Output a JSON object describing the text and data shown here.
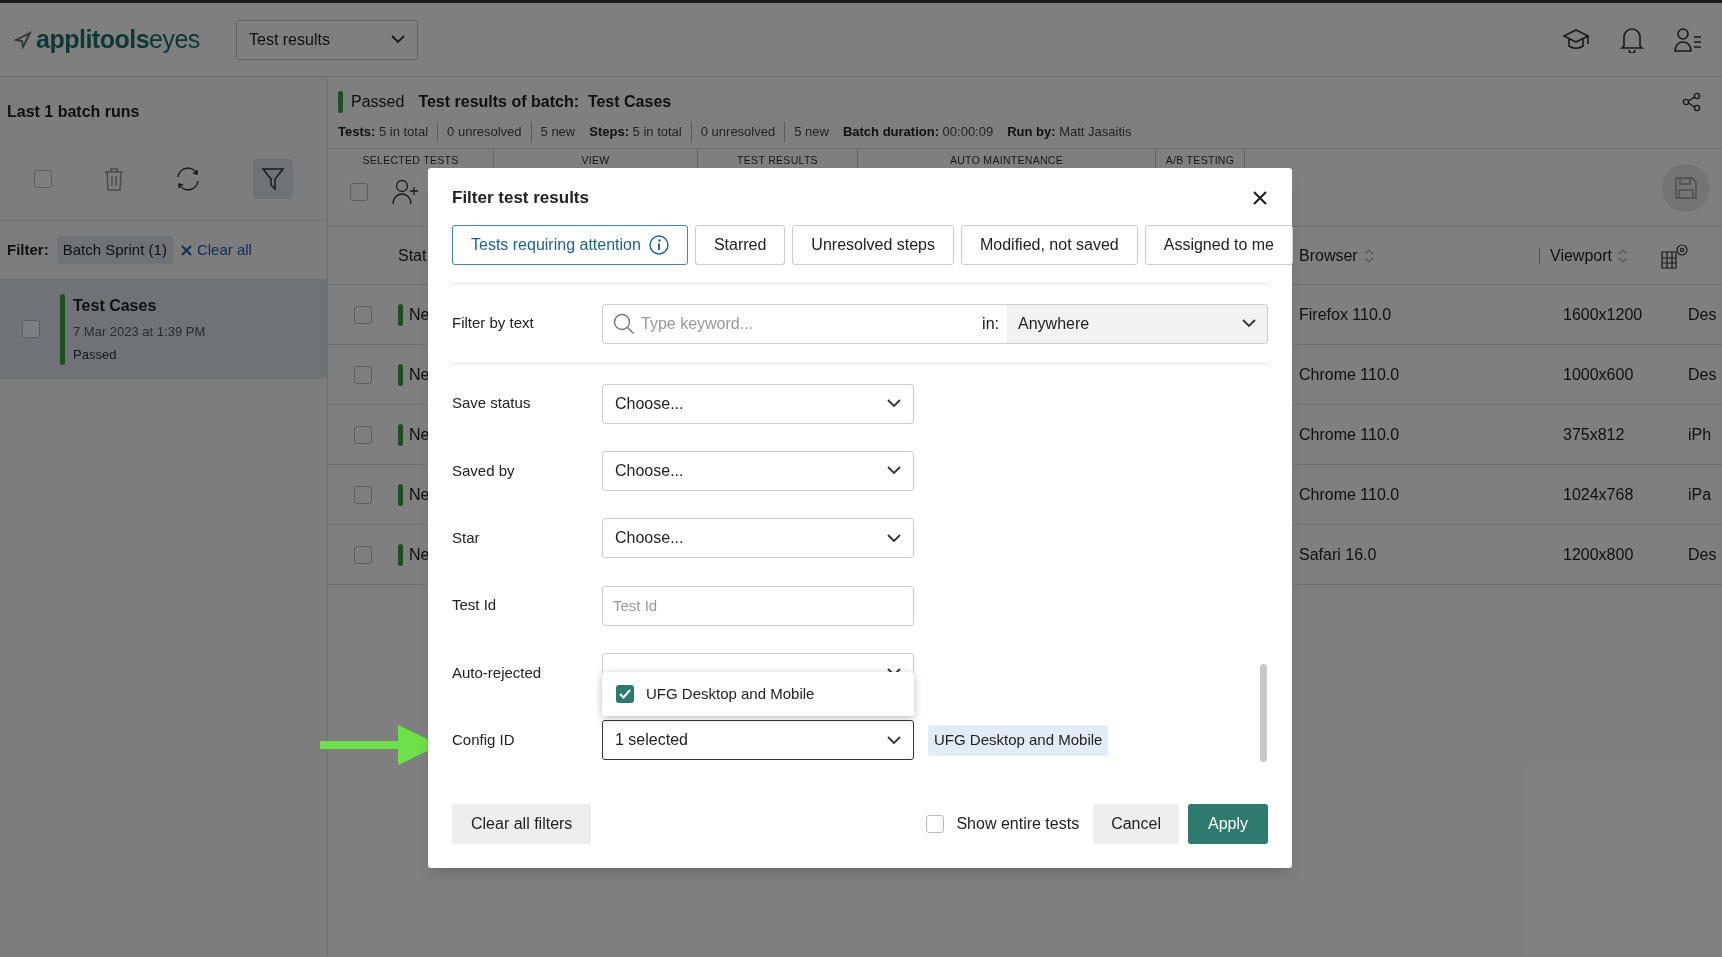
{
  "header": {
    "logo": {
      "brand": "applitools",
      "product": "eyes"
    },
    "page_select": "Test results"
  },
  "sidebar": {
    "title": "Last 1 batch runs",
    "filter_label": "Filter:",
    "filter_chip": "Batch Sprint (1)",
    "clear_all": "Clear all",
    "batches": [
      {
        "name": "Test Cases",
        "date": "7 Mar 2023 at 1:39 PM",
        "status": "Passed",
        "selected": true,
        "checked": false
      }
    ],
    "select_all_checked": false
  },
  "batch": {
    "status": "Passed",
    "select_all_checked": false,
    "title_label": "Test results of batch:",
    "title": "Test Cases",
    "stats": [
      {
        "label": "Tests:",
        "value": "5 in total"
      },
      {
        "value": "0 unresolved"
      },
      {
        "value": "5 new"
      },
      {
        "label": "Steps:",
        "value": "5 in total"
      },
      {
        "value": "0 unresolved"
      },
      {
        "value": "5 new"
      },
      {
        "label": "Batch duration:",
        "value": "00:00:09"
      },
      {
        "label": "Run by:",
        "value": "Matt Jasaitis"
      }
    ]
  },
  "toolbar_sections": [
    "SELECTED TESTS",
    "VIEW",
    "TEST RESULTS",
    "AUTO MAINTENANCE",
    "A/B TESTING"
  ],
  "table": {
    "columns": [
      "Stat",
      "Browser",
      "Viewport"
    ],
    "rows": [
      {
        "status": "Ne",
        "checked": false,
        "browser": "Firefox 110.0",
        "viewport": "1600x1200",
        "column_4": "Des"
      },
      {
        "status": "Ne",
        "checked": false,
        "browser": "Chrome 110.0",
        "viewport": "1000x600",
        "column_4": "Des"
      },
      {
        "status": "Ne",
        "checked": false,
        "browser": "Chrome 110.0",
        "viewport": "375x812",
        "column_4": "iPh"
      },
      {
        "status": "Ne",
        "checked": false,
        "browser": "Chrome 110.0",
        "viewport": "1024x768",
        "column_4": "iPa"
      },
      {
        "status": "Ne",
        "checked": false,
        "browser": "Safari 16.0",
        "viewport": "1200x800",
        "column_4": "Des"
      }
    ]
  },
  "dialog": {
    "title": "Filter test results",
    "quick_filters": [
      {
        "label": "Tests requiring attention",
        "selected": true,
        "info": true
      },
      {
        "label": "Starred",
        "selected": false
      },
      {
        "label": "Unresolved steps",
        "selected": false
      },
      {
        "label": "Modified, not saved",
        "selected": false
      },
      {
        "label": "Assigned to me",
        "selected": false
      }
    ],
    "filter_by_text": {
      "label": "Filter by text",
      "placeholder": "Type keyword...",
      "in_label": "in:",
      "scope": "Anywhere"
    },
    "fields": [
      {
        "label": "Save status",
        "kind": "select",
        "value": "Choose..."
      },
      {
        "label": "Saved by",
        "kind": "select",
        "value": "Choose..."
      },
      {
        "label": "Star",
        "kind": "select",
        "value": "Choose..."
      },
      {
        "label": "Test Id",
        "kind": "text",
        "placeholder": "Test Id"
      },
      {
        "label": "Auto-rejected",
        "kind": "select"
      },
      {
        "label": "Config ID",
        "kind": "select",
        "value": "1 selected",
        "focused": true,
        "tags": [
          "UFG Desktop and Mobile"
        ],
        "options": [
          {
            "label": "UFG Desktop and Mobile",
            "checked": true
          }
        ]
      }
    ],
    "clear_all": "Clear all filters",
    "show_entire_tests": {
      "label": "Show entire tests",
      "checked": false
    },
    "cancel": "Cancel",
    "apply": "Apply"
  }
}
